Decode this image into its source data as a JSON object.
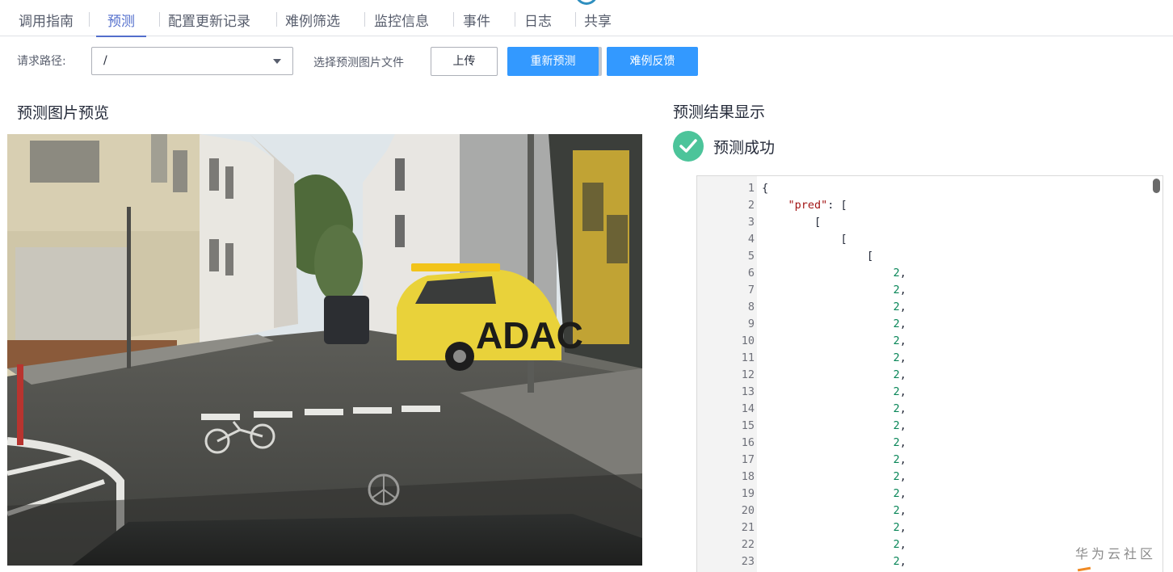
{
  "tabs": [
    {
      "label": "调用指南"
    },
    {
      "label": "预测",
      "active": true
    },
    {
      "label": "配置更新记录"
    },
    {
      "label": "难例筛选"
    },
    {
      "label": "监控信息"
    },
    {
      "label": "事件"
    },
    {
      "label": "日志"
    },
    {
      "label": "共享"
    }
  ],
  "toolbar": {
    "path_label": "请求路径:",
    "path_value": "/",
    "file_label": "选择预测图片文件",
    "upload_label": "上传",
    "repredict_label": "重新预测",
    "feedback_label": "难例反馈"
  },
  "preview": {
    "title": "预测图片预览",
    "image_alt": "street scene with yellow ADAC car",
    "car_text": "ADAC"
  },
  "result": {
    "title": "预测结果显示",
    "status": "预测成功",
    "code_lines": [
      {
        "n": "1",
        "indent": "",
        "parts": [
          [
            "p",
            "{"
          ]
        ]
      },
      {
        "n": "2",
        "indent": "    ",
        "parts": [
          [
            "k",
            "\"pred\""
          ],
          [
            "p",
            ": ["
          ]
        ]
      },
      {
        "n": "3",
        "indent": "        ",
        "parts": [
          [
            "p",
            "["
          ]
        ]
      },
      {
        "n": "4",
        "indent": "            ",
        "parts": [
          [
            "p",
            "["
          ]
        ]
      },
      {
        "n": "5",
        "indent": "                ",
        "parts": [
          [
            "p",
            "["
          ]
        ]
      },
      {
        "n": "6",
        "indent": "                    ",
        "parts": [
          [
            "n",
            "2"
          ],
          [
            "p",
            ","
          ]
        ]
      },
      {
        "n": "7",
        "indent": "                    ",
        "parts": [
          [
            "n",
            "2"
          ],
          [
            "p",
            ","
          ]
        ]
      },
      {
        "n": "8",
        "indent": "                    ",
        "parts": [
          [
            "n",
            "2"
          ],
          [
            "p",
            ","
          ]
        ]
      },
      {
        "n": "9",
        "indent": "                    ",
        "parts": [
          [
            "n",
            "2"
          ],
          [
            "p",
            ","
          ]
        ]
      },
      {
        "n": "10",
        "indent": "                    ",
        "parts": [
          [
            "n",
            "2"
          ],
          [
            "p",
            ","
          ]
        ]
      },
      {
        "n": "11",
        "indent": "                    ",
        "parts": [
          [
            "n",
            "2"
          ],
          [
            "p",
            ","
          ]
        ]
      },
      {
        "n": "12",
        "indent": "                    ",
        "parts": [
          [
            "n",
            "2"
          ],
          [
            "p",
            ","
          ]
        ]
      },
      {
        "n": "13",
        "indent": "                    ",
        "parts": [
          [
            "n",
            "2"
          ],
          [
            "p",
            ","
          ]
        ]
      },
      {
        "n": "14",
        "indent": "                    ",
        "parts": [
          [
            "n",
            "2"
          ],
          [
            "p",
            ","
          ]
        ]
      },
      {
        "n": "15",
        "indent": "                    ",
        "parts": [
          [
            "n",
            "2"
          ],
          [
            "p",
            ","
          ]
        ]
      },
      {
        "n": "16",
        "indent": "                    ",
        "parts": [
          [
            "n",
            "2"
          ],
          [
            "p",
            ","
          ]
        ]
      },
      {
        "n": "17",
        "indent": "                    ",
        "parts": [
          [
            "n",
            "2"
          ],
          [
            "p",
            ","
          ]
        ]
      },
      {
        "n": "18",
        "indent": "                    ",
        "parts": [
          [
            "n",
            "2"
          ],
          [
            "p",
            ","
          ]
        ]
      },
      {
        "n": "19",
        "indent": "                    ",
        "parts": [
          [
            "n",
            "2"
          ],
          [
            "p",
            ","
          ]
        ]
      },
      {
        "n": "20",
        "indent": "                    ",
        "parts": [
          [
            "n",
            "2"
          ],
          [
            "p",
            ","
          ]
        ]
      },
      {
        "n": "21",
        "indent": "                    ",
        "parts": [
          [
            "n",
            "2"
          ],
          [
            "p",
            ","
          ]
        ]
      },
      {
        "n": "22",
        "indent": "                    ",
        "parts": [
          [
            "n",
            "2"
          ],
          [
            "p",
            ","
          ]
        ]
      },
      {
        "n": "23",
        "indent": "                    ",
        "parts": [
          [
            "n",
            "2"
          ],
          [
            "p",
            ","
          ]
        ]
      }
    ]
  },
  "watermark": "华为云社区",
  "colors": {
    "accent": "#526ecc",
    "primary_button": "#3399ff",
    "success": "#4cc49a",
    "json_key": "#a31515",
    "json_number": "#098658"
  },
  "icons": {
    "select_caret": "chevron-down-icon",
    "status": "check-circle-icon"
  }
}
